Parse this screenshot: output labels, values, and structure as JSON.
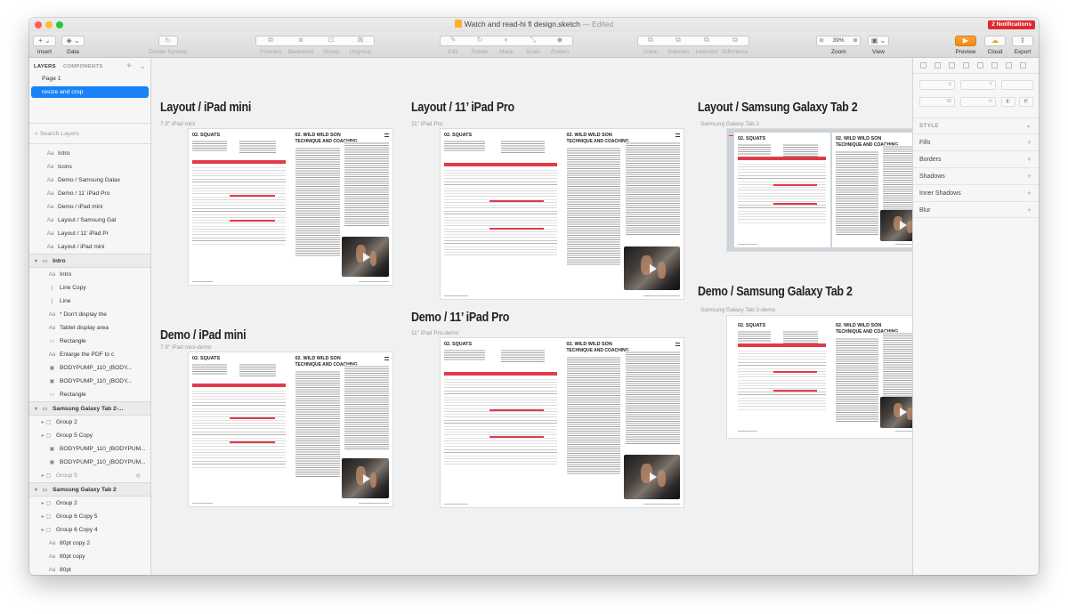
{
  "app": {
    "title": "Watch and read-hi fi design.sketch",
    "edited": "— Edited",
    "notifications": "2 Notifications"
  },
  "toolbar": {
    "insert": "Insert",
    "data": "Data",
    "create_symbol": "Create Symbol",
    "forward": "Forward",
    "backward": "Backward",
    "group": "Group",
    "ungroup": "Ungroup",
    "edit": "Edit",
    "rotate": "Rotate",
    "mask": "Mask",
    "scale": "Scale",
    "flatten": "Flatten",
    "union": "Union",
    "subtract": "Subtract",
    "intersect": "Intersect",
    "difference": "Difference",
    "zoom_label": "Zoom",
    "zoom_value": "39%",
    "zoom_minus": "⊖",
    "zoom_plus": "⊕",
    "view": "View",
    "preview": "Preview",
    "cloud": "Cloud",
    "export": "Export"
  },
  "layers_panel": {
    "tab_layers": "LAYERS",
    "tab_components": "COMPONENTS",
    "pages": [
      "Page 1",
      "resize and crop"
    ],
    "search_placeholder": "Search Layers",
    "items": [
      {
        "label": "Intro",
        "icon": "Aa",
        "indent": 0,
        "kind": "text"
      },
      {
        "label": "Icons",
        "icon": "Aa",
        "indent": 0,
        "kind": "text"
      },
      {
        "label": "Demo / Samsung Galax",
        "icon": "Aa",
        "indent": 0,
        "kind": "text"
      },
      {
        "label": "Demo / 11’ iPad Pro",
        "icon": "Aa",
        "indent": 0,
        "kind": "text"
      },
      {
        "label": "Demo / iPad mini",
        "icon": "Aa",
        "indent": 0,
        "kind": "text"
      },
      {
        "label": "Layout / Samsung Gal",
        "icon": "Aa",
        "indent": 0,
        "kind": "text"
      },
      {
        "label": "Layout / 11’ iPad Pr",
        "icon": "Aa",
        "indent": 0,
        "kind": "text"
      },
      {
        "label": "Layout / iPad mini",
        "icon": "Aa",
        "indent": 0,
        "kind": "text"
      },
      {
        "label": "Intro",
        "icon": "▭",
        "indent": 0,
        "kind": "header"
      },
      {
        "label": "Intro",
        "icon": "Aa",
        "indent": 1,
        "kind": "text"
      },
      {
        "label": "Line Copy",
        "icon": "|",
        "indent": 1,
        "kind": "line"
      },
      {
        "label": "Line",
        "icon": "|",
        "indent": 1,
        "kind": "line"
      },
      {
        "label": "* Don't display the",
        "icon": "Aa",
        "indent": 1,
        "kind": "text"
      },
      {
        "label": "Tablet display area",
        "icon": "Aa",
        "indent": 1,
        "kind": "text"
      },
      {
        "label": "Rectangle",
        "icon": "▭",
        "indent": 1,
        "kind": "shape"
      },
      {
        "label": "Enlarge the PDF to c",
        "icon": "Aa",
        "indent": 1,
        "kind": "text"
      },
      {
        "label": "BODYPUMP_110_(BODY...",
        "icon": "▣",
        "indent": 1,
        "kind": "image"
      },
      {
        "label": "BODYPUMP_110_(BODY...",
        "icon": "▣",
        "indent": 1,
        "kind": "image"
      },
      {
        "label": "Rectangle",
        "icon": "▭",
        "indent": 1,
        "kind": "shape"
      },
      {
        "label": "Samsung Galaxy Tab 2-...",
        "icon": "▭",
        "indent": 0,
        "kind": "header"
      },
      {
        "label": "Group 2",
        "icon": "▸ ▢",
        "indent": 1,
        "kind": "group"
      },
      {
        "label": "Group 5 Copy",
        "icon": "▸ ▢",
        "indent": 1,
        "kind": "group"
      },
      {
        "label": "BODYPUMP_110_(BODYPUM...",
        "icon": "▣",
        "indent": 1,
        "kind": "image"
      },
      {
        "label": "BODYPUMP_110_(BODYPUM...",
        "icon": "▣",
        "indent": 1,
        "kind": "image"
      },
      {
        "label": "Group 5",
        "icon": "▸ ▢",
        "indent": 1,
        "kind": "group-hidden"
      },
      {
        "label": "Samsung Galaxy Tab 2",
        "icon": "▭",
        "indent": 0,
        "kind": "header"
      },
      {
        "label": "Group 2",
        "icon": "▸ ▢",
        "indent": 1,
        "kind": "group"
      },
      {
        "label": "Group 6 Copy 5",
        "icon": "▸ ▢",
        "indent": 1,
        "kind": "group"
      },
      {
        "label": "Group 6 Copy 4",
        "icon": "▸ ▢",
        "indent": 1,
        "kind": "group"
      },
      {
        "label": "80pt copy 2",
        "icon": "Aa",
        "indent": 1,
        "kind": "text"
      },
      {
        "label": "80pt copy",
        "icon": "Aa",
        "indent": 1,
        "kind": "text"
      },
      {
        "label": "80pt",
        "icon": "Aa",
        "indent": 1,
        "kind": "text"
      }
    ]
  },
  "canvas": {
    "artboards": [
      {
        "id": "layout-ipad-mini",
        "title": "Layout / iPad mini",
        "subtitle": "7.9\" iPad mini"
      },
      {
        "id": "layout-11-ipad-pro",
        "title": "Layout / 11’ iPad Pro",
        "subtitle": "11\" iPad Pro"
      },
      {
        "id": "layout-galaxy-tab2",
        "title": "Layout / Samsung Galaxy Tab 2",
        "subtitle": "Samsung Galaxy Tab 2"
      },
      {
        "id": "demo-ipad-mini",
        "title": "Demo / iPad mini",
        "subtitle": "7.9\" iPad mini-demo"
      },
      {
        "id": "demo-11-ipad-pro",
        "title": "Demo / 11’ iPad Pro",
        "subtitle": "11\" iPad Pro-demo"
      },
      {
        "id": "demo-galaxy-tab2",
        "title": "Demo / Samsung Galaxy Tab 2",
        "subtitle": "Samsung Galaxy Tab 2-demo"
      }
    ],
    "page_left_heading": "02. SQUATS",
    "page_right_heading": "02. WILD WILD SON",
    "page_right_subheading": "TECHNIQUE AND COACHING"
  },
  "inspector": {
    "field_x": "X",
    "field_y": "Y",
    "field_w": "W",
    "field_h": "H",
    "style_header": "STYLE",
    "sections": [
      "Fills",
      "Borders",
      "Shadows",
      "Inner Shadows",
      "Blur"
    ]
  },
  "colors": {
    "selection_blue": "#1a82f6",
    "accent_red": "#e23a47",
    "notification_red": "#e0282e",
    "preview_orange": "#f08a12"
  }
}
